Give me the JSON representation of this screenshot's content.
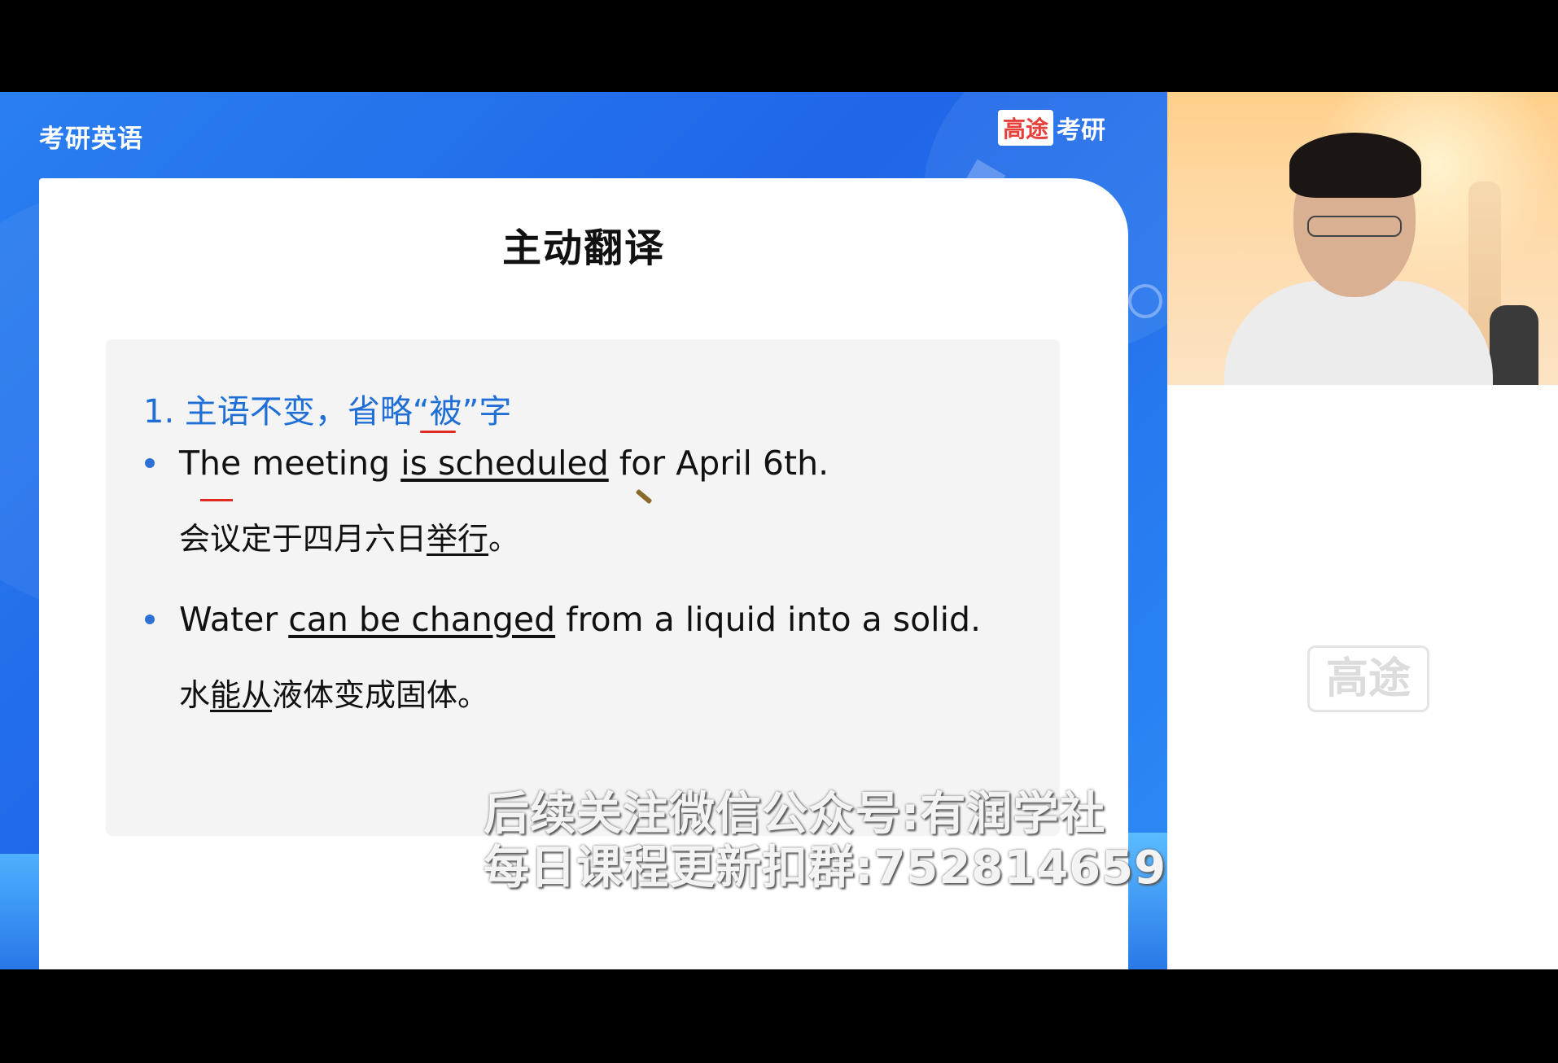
{
  "header": {
    "course_title": "考研英语",
    "brand_box": "高途",
    "brand_text": "考研"
  },
  "slide": {
    "title": "主动翻译",
    "rule": "1. 主语不变，省略“被”字",
    "examples": [
      {
        "en_pre": "The meeting ",
        "en_underlined": "is scheduled",
        "en_post": " for April 6th.",
        "zh_pre": "会议定于四月六日",
        "zh_underlined": "举行",
        "zh_post": "。"
      },
      {
        "en_pre": "Water ",
        "en_underlined": "can be changed",
        "en_post": " from a liquid into a solid.",
        "zh_pre": "水",
        "zh_underlined": "能从",
        "zh_post": "液体变成固体。"
      }
    ]
  },
  "watermark": {
    "line1": "后续关注微信公众号:有润学社",
    "line2": "每日课程更新扣群:752814659"
  },
  "side_panel": {
    "logo_watermark": "高途"
  },
  "colors": {
    "slide_bg": "#2a7ff0",
    "rule_text": "#1f6fd6",
    "annotation_red": "#e02a20"
  }
}
